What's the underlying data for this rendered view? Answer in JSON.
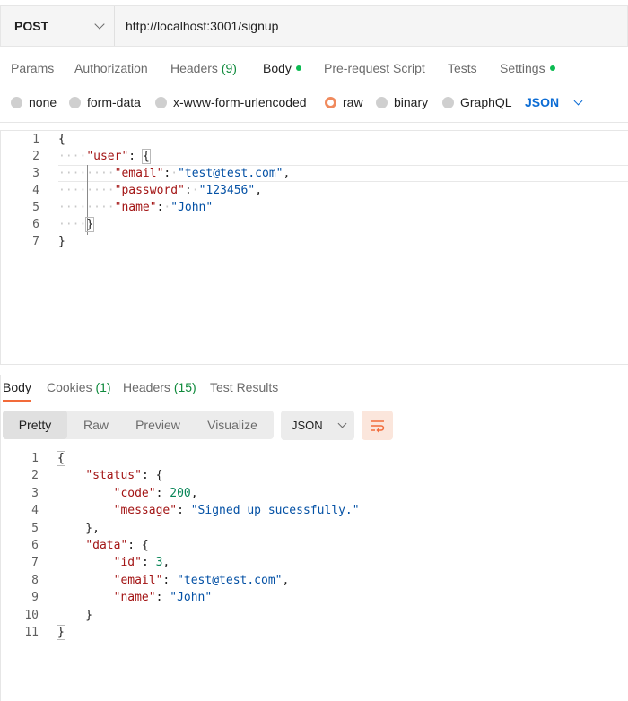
{
  "request": {
    "method": "POST",
    "url": "http://localhost:3001/signup"
  },
  "request_tabs": [
    {
      "label": "Params"
    },
    {
      "label": "Authorization"
    },
    {
      "label": "Headers",
      "count": "(9)"
    },
    {
      "label": "Body"
    },
    {
      "label": "Pre-request Script"
    },
    {
      "label": "Tests"
    },
    {
      "label": "Settings"
    }
  ],
  "body_types": {
    "options": [
      "none",
      "form-data",
      "x-www-form-urlencoded",
      "raw",
      "binary",
      "GraphQL"
    ],
    "selected": "raw",
    "language": "JSON"
  },
  "request_body_lines": [
    {
      "n": "1"
    },
    {
      "n": "2"
    },
    {
      "n": "3"
    },
    {
      "n": "4"
    },
    {
      "n": "5"
    },
    {
      "n": "6"
    },
    {
      "n": "7"
    }
  ],
  "request_body": {
    "open_brace": "{",
    "user_key": "\"user\"",
    "email_key": "\"email\"",
    "email_val": "\"test@test.com\"",
    "password_key": "\"password\"",
    "password_val": "\"123456\"",
    "name_key": "\"name\"",
    "name_val": "\"John\""
  },
  "response_tabs": [
    {
      "label": "Body"
    },
    {
      "label": "Cookies",
      "count": "(1)"
    },
    {
      "label": "Headers",
      "count": "(15)"
    },
    {
      "label": "Test Results"
    }
  ],
  "response_format": {
    "modes": [
      "Pretty",
      "Raw",
      "Preview",
      "Visualize"
    ],
    "active": "Pretty",
    "language": "JSON"
  },
  "response_lines": [
    {
      "n": "1"
    },
    {
      "n": "2"
    },
    {
      "n": "3"
    },
    {
      "n": "4"
    },
    {
      "n": "5"
    },
    {
      "n": "6"
    },
    {
      "n": "7"
    },
    {
      "n": "8"
    },
    {
      "n": "9"
    },
    {
      "n": "10"
    },
    {
      "n": "11"
    }
  ],
  "response_body": {
    "status_key": "\"status\"",
    "code_key": "\"code\"",
    "code_val": "200",
    "message_key": "\"message\"",
    "message_val": "\"Signed up sucessfully.\"",
    "data_key": "\"data\"",
    "id_key": "\"id\"",
    "id_val": "3",
    "email_key": "\"email\"",
    "email_val": "\"test@test.com\"",
    "name_key": "\"name\"",
    "name_val": "\"John\""
  },
  "colors": {
    "accent": "#f26b3a",
    "json_blue": "#0c6cd4",
    "count_green": "#0f8a3c",
    "key_red": "#a31515",
    "string_blue": "#0451a5",
    "number_green": "#098658"
  }
}
